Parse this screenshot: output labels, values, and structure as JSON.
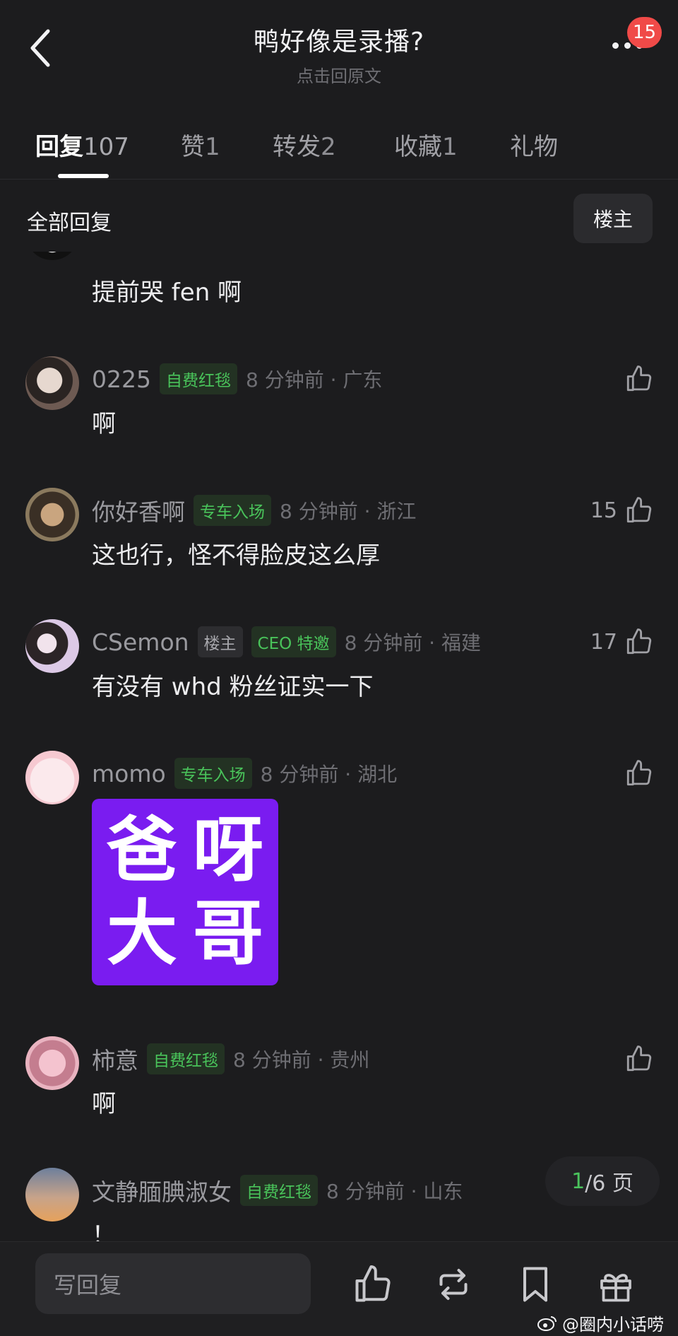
{
  "header": {
    "title": "鸭好像是录播?",
    "subtitle": "点击回原文",
    "notification_count": "15"
  },
  "tabs": [
    {
      "label": "回复",
      "count": "107"
    },
    {
      "label": "赞",
      "count": "1"
    },
    {
      "label": "转发",
      "count": "2"
    },
    {
      "label": "收藏",
      "count": "1"
    },
    {
      "label": "礼物",
      "count": ""
    }
  ],
  "filter": {
    "label": "全部回复",
    "owner_button": "楼主"
  },
  "comments": [
    {
      "username": "",
      "tags": [],
      "time": "",
      "likes": "",
      "text": "提前哭 fen 啊"
    },
    {
      "username": "0225",
      "tags": [
        "自费红毯"
      ],
      "time": "8 分钟前 · 广东",
      "likes": "",
      "text": "啊"
    },
    {
      "username": "你好香啊",
      "tags": [
        "专车入场"
      ],
      "time": "8 分钟前 · 浙江",
      "likes": "15",
      "text": "这也行，怪不得脸皮这么厚"
    },
    {
      "username": "CSemon",
      "tags": [
        "楼主",
        "CEO 特邀"
      ],
      "time": "8 分钟前 · 福建",
      "likes": "17",
      "text": "有没有 whd 粉丝证实一下"
    },
    {
      "username": "momo",
      "tags": [
        "专车入场"
      ],
      "time": "8 分钟前 · 湖北",
      "likes": "",
      "sticker": [
        "爸",
        "呀",
        "大",
        "哥"
      ]
    },
    {
      "username": "柿意",
      "tags": [
        "自费红毯"
      ],
      "time": "8 分钟前 · 贵州",
      "likes": "",
      "text": "啊"
    },
    {
      "username": "文静腼腆淑女",
      "tags": [
        "自费红毯"
      ],
      "time": "8 分钟前 · 山东",
      "likes": "",
      "text": "！"
    }
  ],
  "pager": {
    "current": "1",
    "total": "/6 页"
  },
  "bottom_bar": {
    "reply_placeholder": "写回复"
  },
  "watermark": "@圈内小话唠",
  "colors": {
    "background": "#1c1c1e",
    "tag_green": "#49c35a",
    "badge_red": "#f04a48",
    "sticker_purple": "#7a1cf0"
  },
  "icons": [
    "back-arrow-icon",
    "more-icon",
    "like-icon",
    "repost-icon",
    "bookmark-icon",
    "gift-icon",
    "weibo-icon"
  ]
}
